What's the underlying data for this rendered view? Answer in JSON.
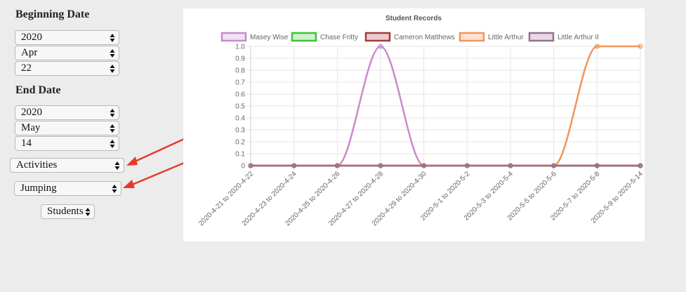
{
  "controls": {
    "beginning_heading": "Beginning Date",
    "begin_year": "2020",
    "begin_month": "Apr",
    "begin_day": "22",
    "end_heading": "End Date",
    "end_year": "2020",
    "end_month": "May",
    "end_day": "14",
    "category": "Activities",
    "activity": "Jumping",
    "group": "Students"
  },
  "colors": {
    "annotation_arrow": "#e8392b",
    "page_bg": "#ececec"
  },
  "chart_data": {
    "type": "line",
    "title": "Student Records",
    "xlabel": "",
    "ylabel": "",
    "ylim": [
      0,
      1.0
    ],
    "yticks": [
      "0",
      "0.1",
      "0.2",
      "0.3",
      "0.4",
      "0.5",
      "0.6",
      "0.7",
      "0.8",
      "0.9",
      "1.0"
    ],
    "grid": true,
    "legend_position": "top",
    "categories": [
      "2020-4-21 to 2020-4-22",
      "2020-4-23 to 2020-4-24",
      "2020-4-25 to 2020-4-26",
      "2020-4-27 to 2020-4-28",
      "2020-4-29 to 2020-4-30",
      "2020-5-1 to 2020-5-2",
      "2020-5-3 to 2020-5-4",
      "2020-5-5 to 2020-5-6",
      "2020-5-7 to 2020-5-8",
      "2020-5-9 to 2020-5-14"
    ],
    "series": [
      {
        "name": "Masey Wise",
        "color": "#c78bc9",
        "values": [
          0,
          0,
          0,
          1,
          0,
          0,
          0,
          0,
          0,
          0
        ]
      },
      {
        "name": "Chase Fritty",
        "color": "#3ec23a",
        "values": [
          0,
          0,
          0,
          0,
          0,
          0,
          0,
          0,
          0,
          0
        ]
      },
      {
        "name": "Cameron Matthews",
        "color": "#a33a3a",
        "values": [
          0,
          0,
          0,
          0,
          0,
          0,
          0,
          0,
          0,
          0
        ]
      },
      {
        "name": "Little Arthur",
        "color": "#f0955a",
        "values": [
          0,
          0,
          0,
          0,
          0,
          0,
          0,
          0,
          1,
          1
        ]
      },
      {
        "name": "Little Arthur II",
        "color": "#9b6f8f",
        "values": [
          0,
          0,
          0,
          0,
          0,
          0,
          0,
          0,
          0,
          0
        ]
      }
    ]
  }
}
